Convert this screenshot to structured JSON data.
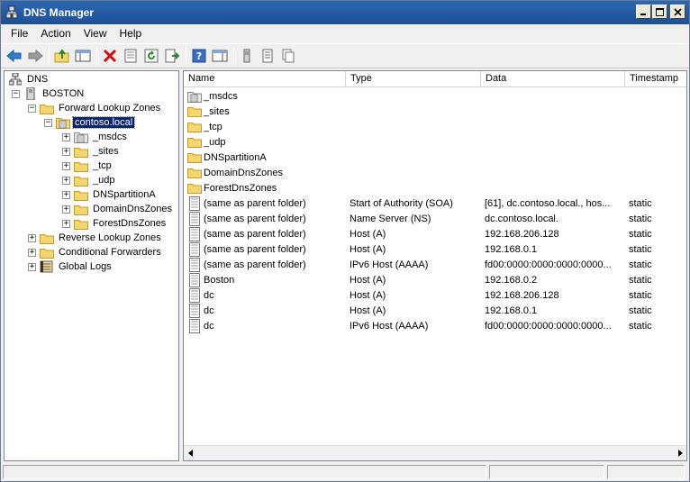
{
  "window": {
    "title": "DNS Manager"
  },
  "menu": [
    "File",
    "Action",
    "View",
    "Help"
  ],
  "tree": {
    "root": "DNS",
    "server": "BOSTON",
    "forward_zones": "Forward Lookup Zones",
    "zone": "contoso.local",
    "zone_children": [
      "_msdcs",
      "_sites",
      "_tcp",
      "_udp",
      "DNSpartitionA",
      "DomainDnsZones",
      "ForestDnsZones"
    ],
    "reverse_zones": "Reverse Lookup Zones",
    "conditional_forwarders": "Conditional Forwarders",
    "global_logs": "Global Logs"
  },
  "list": {
    "columns": [
      "Name",
      "Type",
      "Data",
      "Timestamp"
    ],
    "rows": [
      {
        "icon": "folder-doc-icon",
        "name": "_msdcs",
        "type": "",
        "data": "",
        "ts": ""
      },
      {
        "icon": "folder-icon",
        "name": "_sites",
        "type": "",
        "data": "",
        "ts": ""
      },
      {
        "icon": "folder-icon",
        "name": "_tcp",
        "type": "",
        "data": "",
        "ts": ""
      },
      {
        "icon": "folder-icon",
        "name": "_udp",
        "type": "",
        "data": "",
        "ts": ""
      },
      {
        "icon": "folder-icon",
        "name": "DNSpartitionA",
        "type": "",
        "data": "",
        "ts": ""
      },
      {
        "icon": "folder-icon",
        "name": "DomainDnsZones",
        "type": "",
        "data": "",
        "ts": ""
      },
      {
        "icon": "folder-icon",
        "name": "ForestDnsZones",
        "type": "",
        "data": "",
        "ts": ""
      },
      {
        "icon": "record-icon",
        "name": "(same as parent folder)",
        "type": "Start of Authority (SOA)",
        "data": "[61], dc.contoso.local., hos...",
        "ts": "static"
      },
      {
        "icon": "record-icon",
        "name": "(same as parent folder)",
        "type": "Name Server (NS)",
        "data": "dc.contoso.local.",
        "ts": "static"
      },
      {
        "icon": "record-icon",
        "name": "(same as parent folder)",
        "type": "Host (A)",
        "data": "192.168.206.128",
        "ts": "static"
      },
      {
        "icon": "record-icon",
        "name": "(same as parent folder)",
        "type": "Host (A)",
        "data": "192.168.0.1",
        "ts": "static"
      },
      {
        "icon": "record-icon",
        "name": "(same as parent folder)",
        "type": "IPv6 Host (AAAA)",
        "data": "fd00:0000:0000:0000:0000...",
        "ts": "static"
      },
      {
        "icon": "record-icon",
        "name": "Boston",
        "type": "Host (A)",
        "data": "192.168.0.2",
        "ts": "static"
      },
      {
        "icon": "record-icon",
        "name": "dc",
        "type": "Host (A)",
        "data": "192.168.206.128",
        "ts": "static"
      },
      {
        "icon": "record-icon",
        "name": "dc",
        "type": "Host (A)",
        "data": "192.168.0.1",
        "ts": "static"
      },
      {
        "icon": "record-icon",
        "name": "dc",
        "type": "IPv6 Host (AAAA)",
        "data": "fd00:0000:0000:0000:0000...",
        "ts": "static"
      }
    ]
  },
  "colors": {
    "titlebar": "#1e4f96",
    "selection": "#0a246a",
    "folder": "#f5d76e"
  }
}
